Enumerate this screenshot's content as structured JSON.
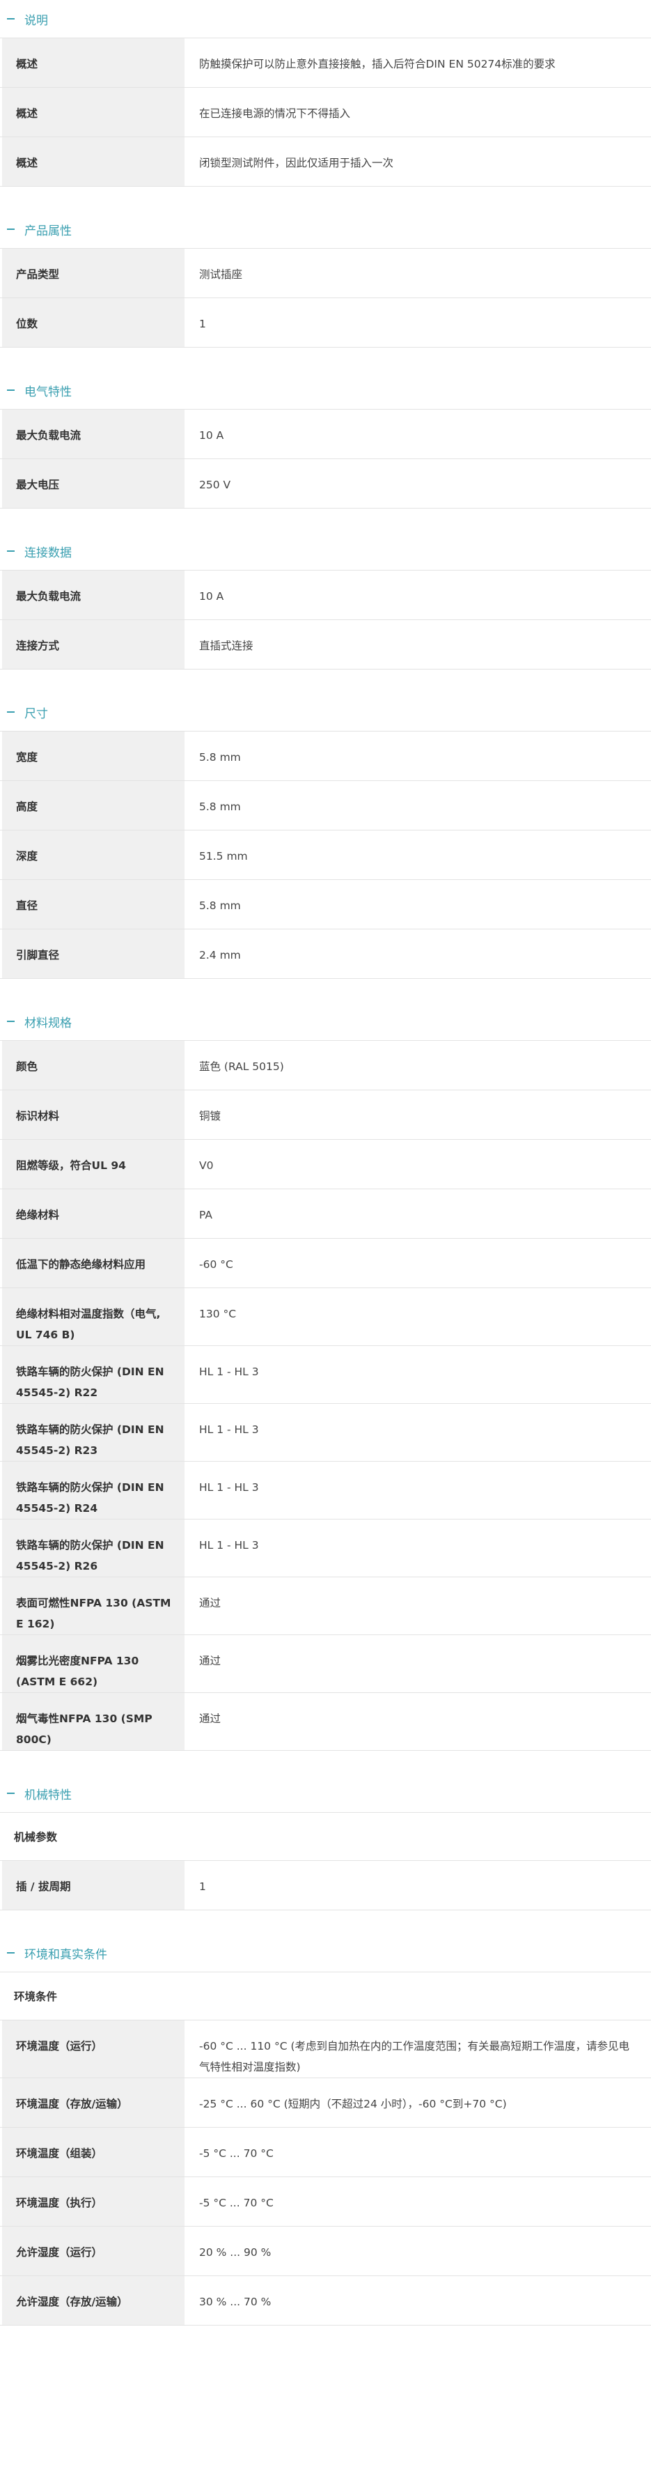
{
  "sections": [
    {
      "title": "说明",
      "height_spacer": true,
      "rows": [
        {
          "label": "概述",
          "value": "防触摸保护可以防止意外直接接触，插入后符合DIN EN 50274标准的要求"
        },
        {
          "label": "概述",
          "value": "在已连接电源的情况下不得插入"
        },
        {
          "label": "概述",
          "value": "闭锁型测试附件，因此仅适用于插入一次"
        }
      ]
    },
    {
      "title": "产品属性",
      "rows": [
        {
          "label": "产品类型",
          "value": "测试插座"
        },
        {
          "label": "位数",
          "value": "1"
        }
      ]
    },
    {
      "title": "电气特性",
      "rows": [
        {
          "label": "最大负载电流",
          "value": "10 A"
        },
        {
          "label": "最大电压",
          "value": "250 V"
        }
      ]
    },
    {
      "title": "连接数据",
      "rows": [
        {
          "label": "最大负载电流",
          "value": "10 A"
        },
        {
          "label": "连接方式",
          "value": "直插式连接"
        }
      ]
    },
    {
      "title": "尺寸",
      "rows": [
        {
          "label": "宽度",
          "value": "5.8 mm"
        },
        {
          "label": "高度",
          "value": "5.8 mm"
        },
        {
          "label": "深度",
          "value": "51.5 mm"
        },
        {
          "label": "直径",
          "value": "5.8 mm"
        },
        {
          "label": "引脚直径",
          "value": "2.4 mm"
        }
      ]
    },
    {
      "title": "材料规格",
      "rows": [
        {
          "label": "颜色",
          "value": "蓝色 (RAL 5015)"
        },
        {
          "label": "标识材料",
          "value": "铜镀"
        },
        {
          "label": "阻燃等级，符合UL 94",
          "value": "V0"
        },
        {
          "label": "绝缘材料",
          "value": "PA"
        },
        {
          "label": "低温下的静态绝缘材料应用",
          "value": "-60 °C"
        },
        {
          "label": "绝缘材料相对温度指数（电气, UL 746 B)",
          "value": "130 °C"
        },
        {
          "label": "铁路车辆的防火保护 (DIN EN 45545-2) R22",
          "value": "HL 1 - HL 3"
        },
        {
          "label": "铁路车辆的防火保护 (DIN EN 45545-2) R23",
          "value": "HL 1 - HL 3"
        },
        {
          "label": "铁路车辆的防火保护 (DIN EN 45545-2) R24",
          "value": "HL 1 - HL 3"
        },
        {
          "label": "铁路车辆的防火保护 (DIN EN 45545-2) R26",
          "value": "HL 1 - HL 3"
        },
        {
          "label": "表面可燃性NFPA 130 (ASTM E 162)",
          "value": "通过"
        },
        {
          "label": "烟雾比光密度NFPA 130 (ASTM E 662)",
          "value": "通过"
        },
        {
          "label": "烟气毒性NFPA 130 (SMP 800C)",
          "value": "通过"
        }
      ]
    },
    {
      "title": "机械特性",
      "group": "机械参数",
      "rows": [
        {
          "label": "插 / 拔周期",
          "value": "1"
        }
      ]
    },
    {
      "title": "环境和真实条件",
      "group": "环境条件",
      "rows": [
        {
          "label": "环境温度（运行）",
          "value": "-60 °C ... 110 °C (考虑到自加热在内的工作温度范围；有关最高短期工作温度，请参见电气特性相对温度指数)"
        },
        {
          "label": "环境温度（存放/运输）",
          "value": "-25 °C ... 60 °C (短期内（不超过24 小时），-60 °C到+70 °C)"
        },
        {
          "label": "环境温度（组装）",
          "value": "-5 °C ... 70 °C"
        },
        {
          "label": "环境温度（执行）",
          "value": "-5 °C ... 70 °C"
        },
        {
          "label": "允许湿度（运行）",
          "value": "20 % ... 90 %"
        },
        {
          "label": "允许湿度（存放/运输）",
          "value": "30 % ... 70 %"
        }
      ]
    }
  ]
}
